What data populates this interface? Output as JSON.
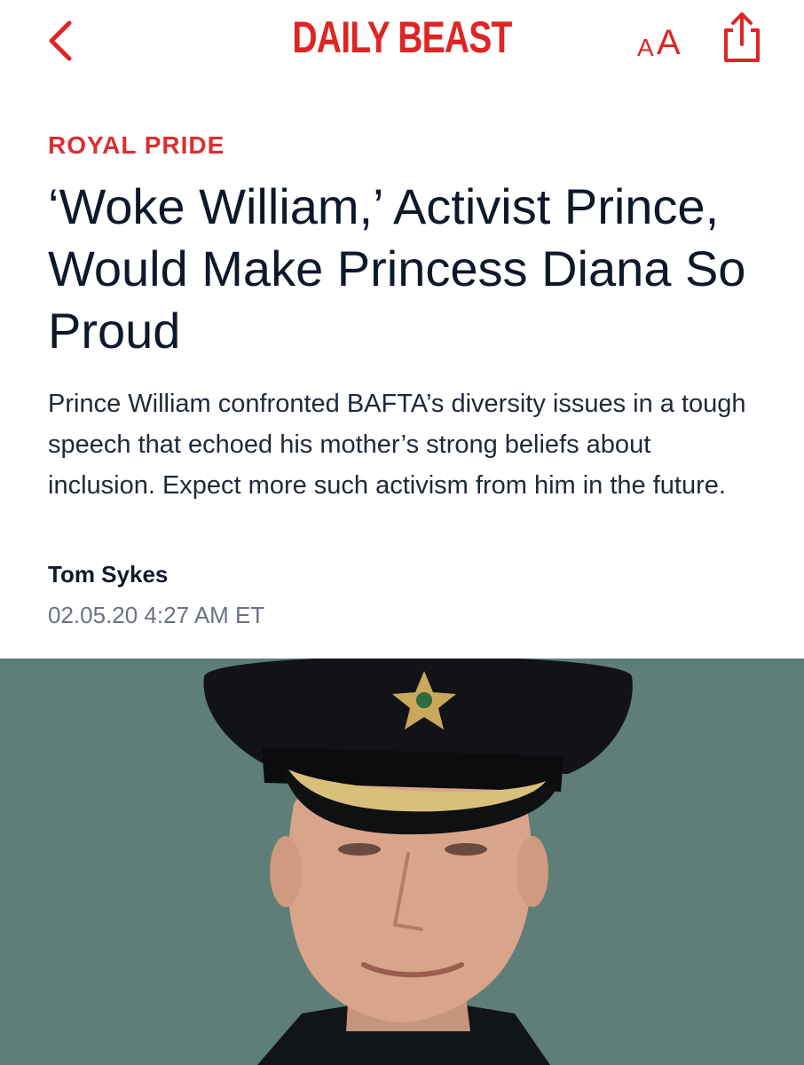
{
  "header": {
    "logo_text": "DAILY BEAST",
    "textsize_small": "A",
    "textsize_large": "A",
    "back_icon": "chevron-left-icon",
    "share_icon": "share-icon",
    "accent_color": "#e02424"
  },
  "article": {
    "section": "ROYAL PRIDE",
    "headline": "‘Woke William,’ Activist Prince, Would Make Princess Diana So Proud",
    "dek": "Prince William confronted BAFTA’s diversity issues in a tough speech that echoed his mother’s strong beliefs about inclusion. Expect more such activism from him in the future.",
    "author": "Tom Sykes",
    "timestamp": "02.05.20 4:27 AM ET"
  },
  "hero_image": {
    "background_color": "#5f7e78"
  }
}
